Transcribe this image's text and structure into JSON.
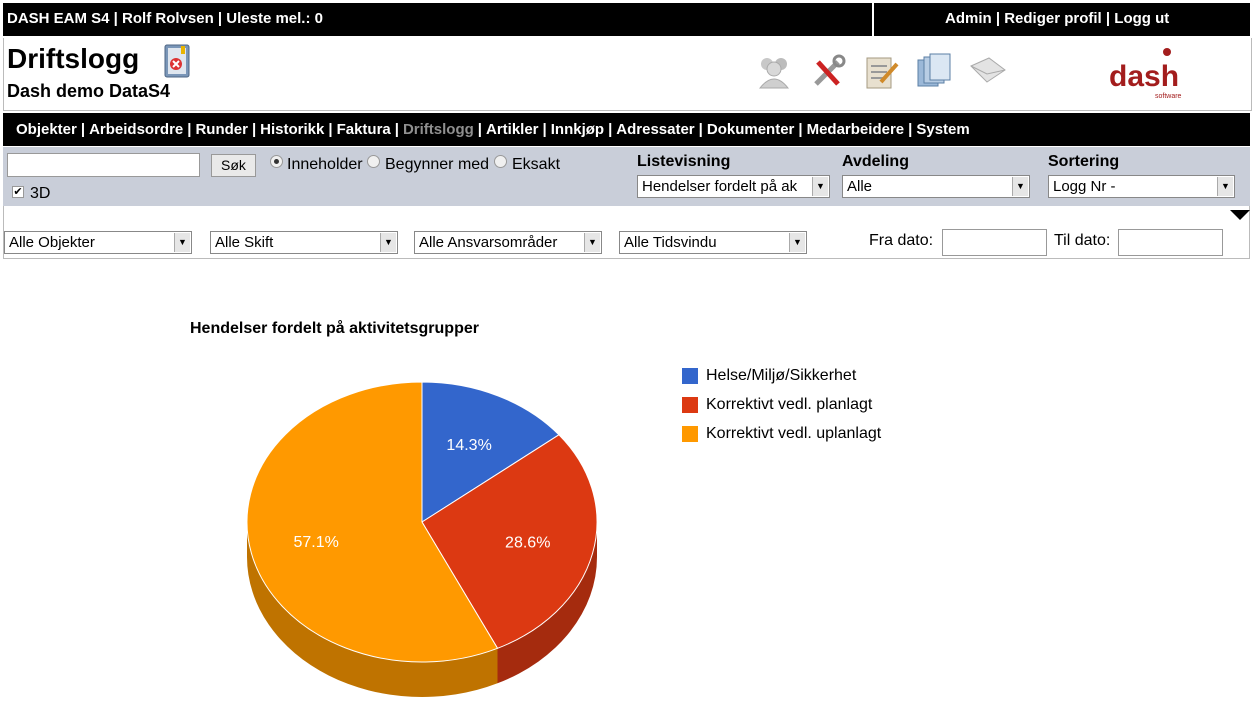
{
  "topbar": {
    "left_text": "DASH EAM S4 | Rolf Rolvsen | Uleste mel.: 0",
    "admin": "Admin",
    "edit_profile": "Rediger profil",
    "logout": "Logg ut",
    "sep": "|"
  },
  "header": {
    "title": "Driftslogg",
    "subtitle": "Dash demo DataS4",
    "logo_text": "dash",
    "logo_sub": "software"
  },
  "nav": {
    "items": [
      "Objekter",
      "Arbeidsordre",
      "Runder",
      "Historikk",
      "Faktura",
      "Driftslogg",
      "Artikler",
      "Innkjøp",
      "Adressater",
      "Dokumenter",
      "Medarbeidere",
      "System"
    ],
    "active": "Driftslogg"
  },
  "filters": {
    "search_value": "",
    "search_button": "Søk",
    "radio_contains": "Inneholder",
    "radio_begins": "Begynner med",
    "radio_exact": "Eksakt",
    "checkbox_3d": "3D",
    "listevisning_label": "Listevisning",
    "listevisning_value": "Hendelser fordelt på ak",
    "avdeling_label": "Avdeling",
    "avdeling_value": "Alle",
    "sortering_label": "Sortering",
    "sortering_value": "Logg Nr -",
    "objekter_value": "Alle Objekter",
    "skift_value": "Alle Skift",
    "ansvar_value": "Alle Ansvarsområder",
    "tidsvindu_value": "Alle Tidsvindu",
    "fra_dato_label": "Fra dato:",
    "til_dato_label": "Til dato:"
  },
  "chart_data": {
    "type": "pie",
    "title": "Hendelser fordelt på aktivitetsgrupper",
    "categories": [
      "Helse/Miljø/Sikkerhet",
      "Korrektivt vedl. planlagt",
      "Korrektivt vedl. uplanlagt"
    ],
    "values": [
      14.3,
      28.6,
      57.1
    ],
    "labels": [
      "14.3%",
      "28.6%",
      "57.1%"
    ],
    "colors": [
      "#3366cc",
      "#dc3912",
      "#ff9900"
    ],
    "side_colors": [
      "#264d99",
      "#a52b0e",
      "#bf7300"
    ],
    "three_d": true,
    "legend_position": "right"
  }
}
